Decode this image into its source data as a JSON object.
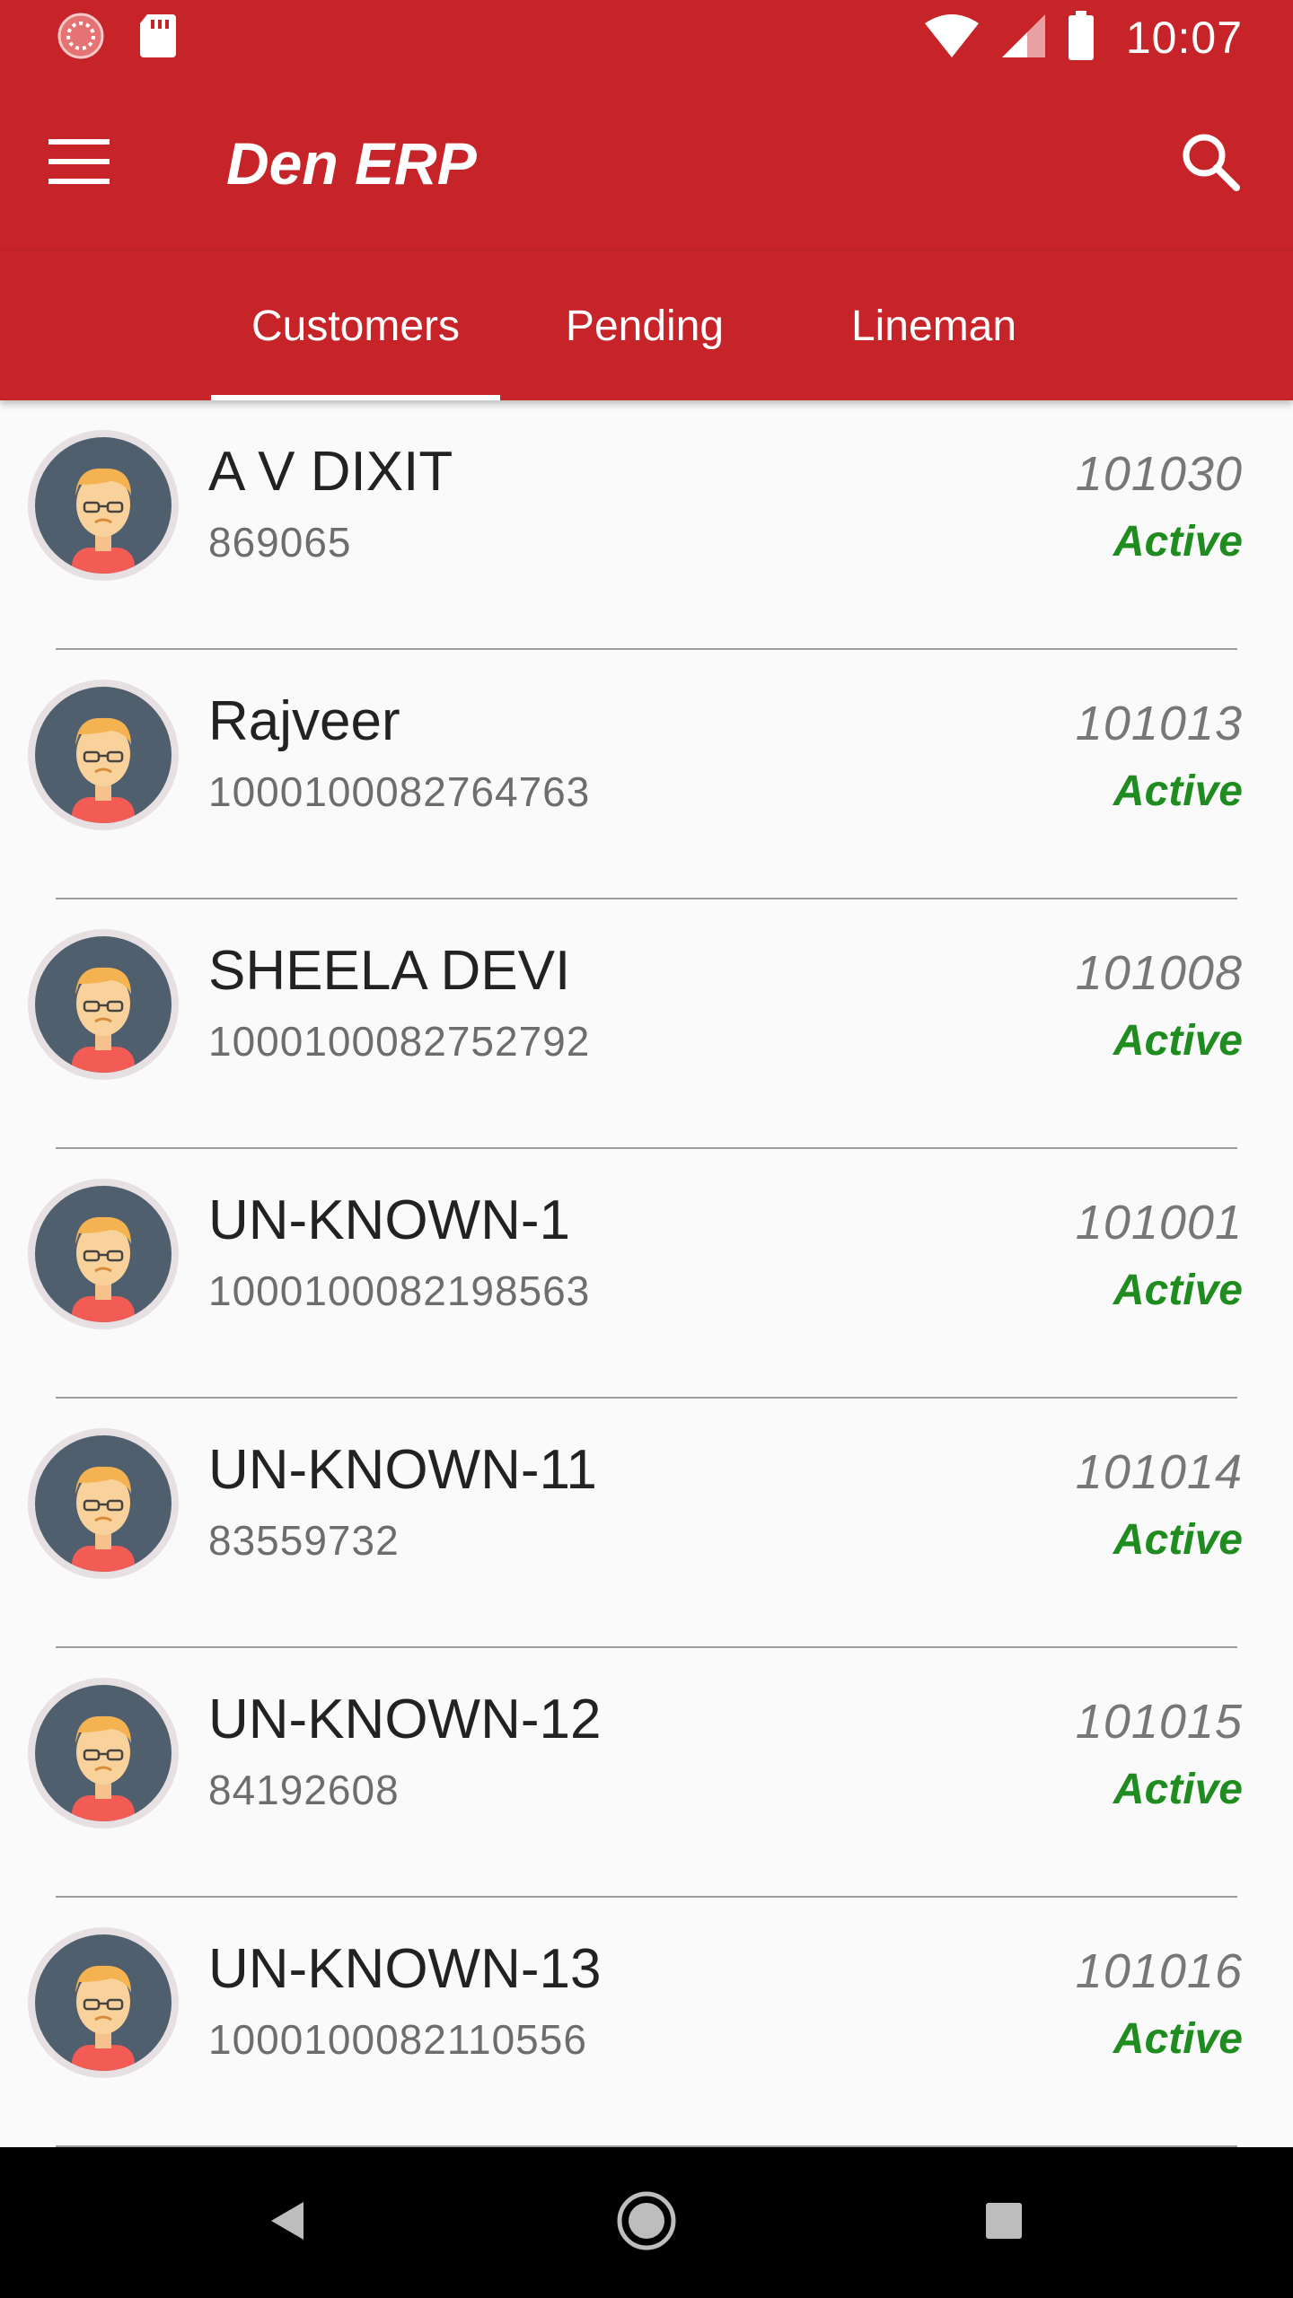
{
  "status_bar": {
    "time": "10:07",
    "icons": [
      "loading-indicator-icon",
      "sd-card-icon",
      "wifi-icon",
      "signal-icon",
      "battery-icon"
    ]
  },
  "toolbar": {
    "title": "Den ERP",
    "menu_icon": "hamburger-menu-icon",
    "search_icon": "search-icon"
  },
  "tabs": [
    {
      "label": "Customers",
      "active": true
    },
    {
      "label": "Pending",
      "active": false
    },
    {
      "label": "Lineman",
      "active": false
    }
  ],
  "customers": [
    {
      "name": "A V DIXIT",
      "number": "869065",
      "code": "101030",
      "status": "Active"
    },
    {
      "name": "Rajveer",
      "number": "1000100082764763",
      "code": "101013",
      "status": "Active"
    },
    {
      "name": "SHEELA DEVI",
      "number": "1000100082752792",
      "code": "101008",
      "status": "Active"
    },
    {
      "name": "UN-KNOWN-1",
      "number": "1000100082198563",
      "code": "101001",
      "status": "Active"
    },
    {
      "name": "UN-KNOWN-11",
      "number": "83559732",
      "code": "101014",
      "status": "Active"
    },
    {
      "name": "UN-KNOWN-12",
      "number": "84192608",
      "code": "101015",
      "status": "Active"
    },
    {
      "name": "UN-KNOWN-13",
      "number": "1000100082110556",
      "code": "101016",
      "status": "Active"
    }
  ],
  "nav_bar": {
    "icons": [
      "back-triangle-icon",
      "home-circle-icon",
      "recents-square-icon"
    ]
  },
  "colors": {
    "primary": "#c62428",
    "active_status": "#1e8c1e",
    "avatar_bg": "#4f5f6e",
    "avatar_ring": "#e6e0e2"
  }
}
